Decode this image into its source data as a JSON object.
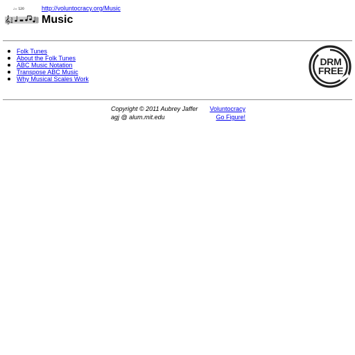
{
  "header": {
    "url": "http://voluntocracy.org/Music",
    "title": "Music",
    "logo_tempo": "♩= 120",
    "logo_icon": "music-staff-icon"
  },
  "nav": {
    "items": [
      {
        "label": "Folk Tunes"
      },
      {
        "label": "About the Folk Tunes"
      },
      {
        "label": "ABC Music Notation"
      },
      {
        "label": "Transpose ABC Music"
      },
      {
        "label": "Why Musical Scales Work"
      }
    ]
  },
  "badge": {
    "line1": "DRM",
    "line2": "FREE",
    "icon": "drm-free-icon"
  },
  "footer": {
    "copyright": "Copyright © 2011 Aubrey Jaffer",
    "email": "agj @ alum.mit.edu",
    "voluntocracy_label": "Voluntocracy",
    "go_figure_label": "Go Figure!"
  },
  "colors": {
    "link": "#0000ee",
    "rule": "#a0a0a0"
  }
}
